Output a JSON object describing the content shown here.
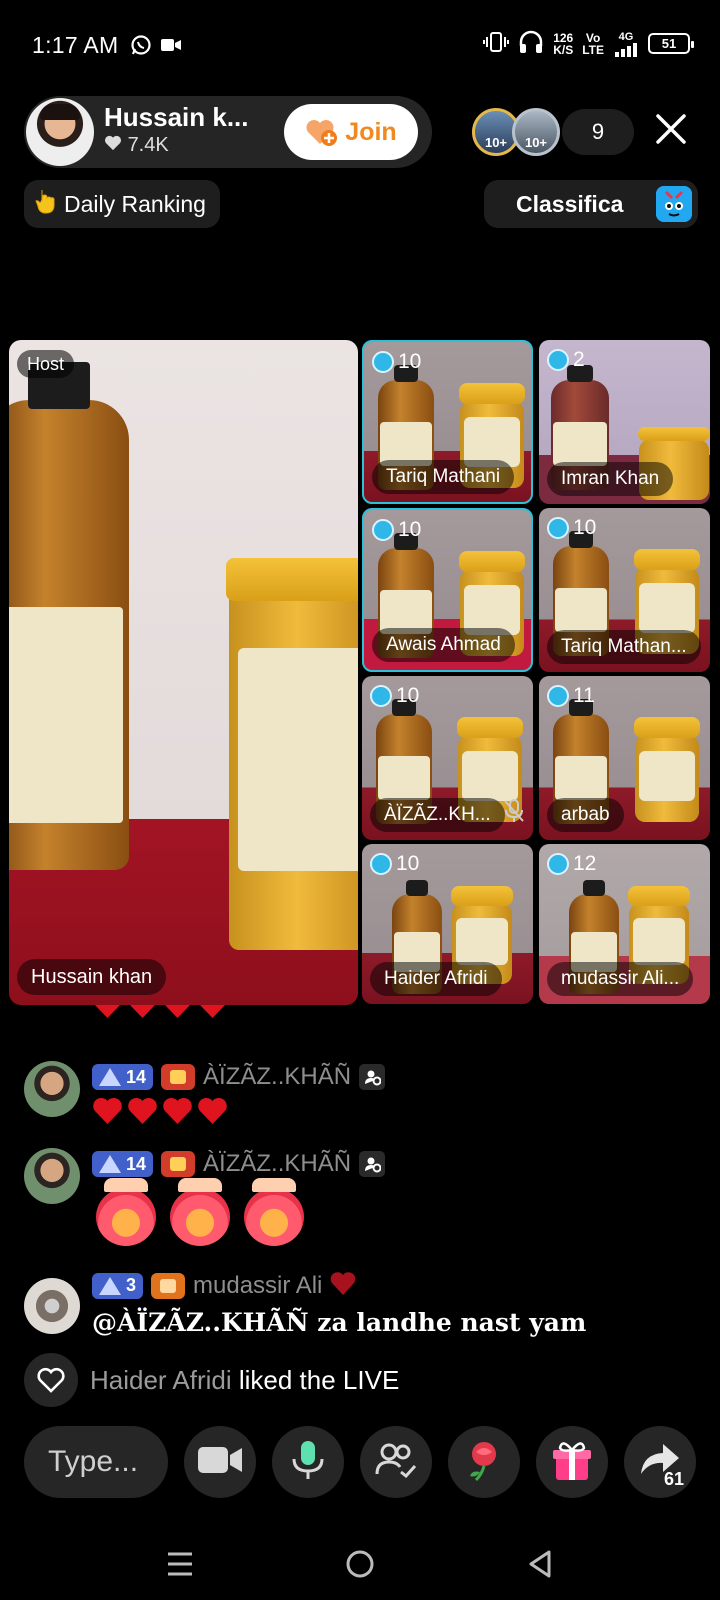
{
  "status_bar": {
    "time": "1:17 AM",
    "net_speed_value": "126",
    "net_speed_unit": "K/S",
    "net_type_top": "Vo",
    "net_type_bottom": "LTE",
    "net_gen": "4G",
    "battery": "51"
  },
  "host": {
    "name": "Hussain k...",
    "likes": "7.4K",
    "join_label": "Join"
  },
  "viewers": {
    "badge_1": "10+",
    "badge_2": "10+",
    "count": "9"
  },
  "ranking": {
    "daily_label": "Daily Ranking",
    "classifica_label": "Classifica"
  },
  "video": {
    "host_tag": "Host",
    "host_name": "Hussain khan",
    "guests": [
      {
        "name": "Tariq Mathani",
        "level": "10"
      },
      {
        "name": "Imran Khan",
        "level": "2"
      },
      {
        "name": "Awais Ahmad",
        "level": "10"
      },
      {
        "name": "Tariq Mathan...",
        "level": "10"
      },
      {
        "name": "ÀÏZÃZ..KH...",
        "level": "10"
      },
      {
        "name": "arbab",
        "level": "11"
      },
      {
        "name": "Haider Afridi",
        "level": "10"
      },
      {
        "name": "mudassir Ali...",
        "level": "12"
      }
    ]
  },
  "chat": {
    "messages": [
      {
        "user": "ÀÏZÃZ..KHÃÑ",
        "level": "14",
        "content": "hearts"
      },
      {
        "user": "ÀÏZÃZ..KHÃÑ",
        "level": "14",
        "content": "faces"
      },
      {
        "user": "mudassir Ali",
        "level": "3",
        "text": "@ÀÏZÃZ..KHÃÑ za landhe nast yam"
      }
    ],
    "like_user": "Haider Afridi",
    "like_text": "liked the LIVE"
  },
  "bottom_bar": {
    "input_placeholder": "Type...",
    "share_count": "61"
  },
  "colors": {
    "accent_join": "#f08a20",
    "selected_tile_border": "#2bc2d9",
    "level_badge": "#4260c9",
    "heart_red": "#e0141e"
  },
  "icons": [
    "whatsapp-icon",
    "video-call-icon",
    "vibrate-icon",
    "headphones-icon",
    "signal-icon",
    "battery-icon",
    "heart-icon",
    "close-icon",
    "fire-hand-icon",
    "gift-box-icon",
    "level-star-icon",
    "mic-muted-icon",
    "video-camera-icon",
    "microphone-icon",
    "guests-icon",
    "rose-icon",
    "gift-icon",
    "share-icon",
    "menu-icon",
    "home-icon",
    "back-icon"
  ]
}
